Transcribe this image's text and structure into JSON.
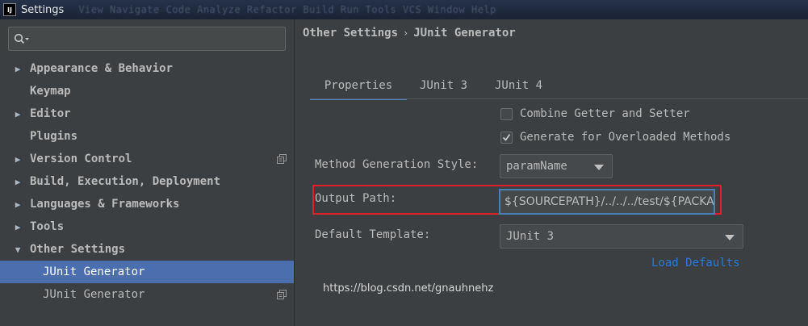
{
  "window": {
    "title": "Settings",
    "app_icon": "IJ",
    "menu_ghost": "View Navigate Code Analyze Refactor Build Run Tools VCS Window Help"
  },
  "search": {
    "placeholder": ""
  },
  "sidebar": {
    "items": [
      {
        "label": "Appearance & Behavior",
        "arrow": "right"
      },
      {
        "label": "Keymap",
        "arrow": "none"
      },
      {
        "label": "Editor",
        "arrow": "right"
      },
      {
        "label": "Plugins",
        "arrow": "none"
      },
      {
        "label": "Version Control",
        "arrow": "right",
        "icon": "copy-icon"
      },
      {
        "label": "Build, Execution, Deployment",
        "arrow": "right"
      },
      {
        "label": "Languages & Frameworks",
        "arrow": "right"
      },
      {
        "label": "Tools",
        "arrow": "right"
      },
      {
        "label": "Other Settings",
        "arrow": "down"
      },
      {
        "label": "JUnit Generator",
        "selected": true
      },
      {
        "label": "JUnit Generator",
        "icon": "copy-icon"
      }
    ]
  },
  "breadcrumb": {
    "parent": "Other Settings",
    "separator": "›",
    "current": "JUnit Generator"
  },
  "tabs": [
    {
      "label": "Properties",
      "active": true
    },
    {
      "label": "JUnit 3",
      "active": false
    },
    {
      "label": "JUnit 4",
      "active": false
    }
  ],
  "checkboxes": [
    {
      "label": "Combine Getter and Setter",
      "checked": false
    },
    {
      "label": "Generate for Overloaded Methods",
      "checked": true
    }
  ],
  "form": {
    "method_style_label": "Method Generation Style:",
    "method_style_value": "paramName",
    "output_path_label": "Output Path:",
    "output_path_value": "${SOURCEPATH}/../../../test/${PACKAGE}/${FILENAME}",
    "default_template_label": "Default Template:",
    "default_template_value": "JUnit 3"
  },
  "load_defaults": "Load Defaults",
  "watermark": "https://blog.csdn.net/gnauhnehz",
  "colors": {
    "background": "#3c3f41",
    "selection": "#4b6eaf",
    "accent": "#4a88c7",
    "link": "#287bde",
    "highlight_box": "#e0202a"
  }
}
